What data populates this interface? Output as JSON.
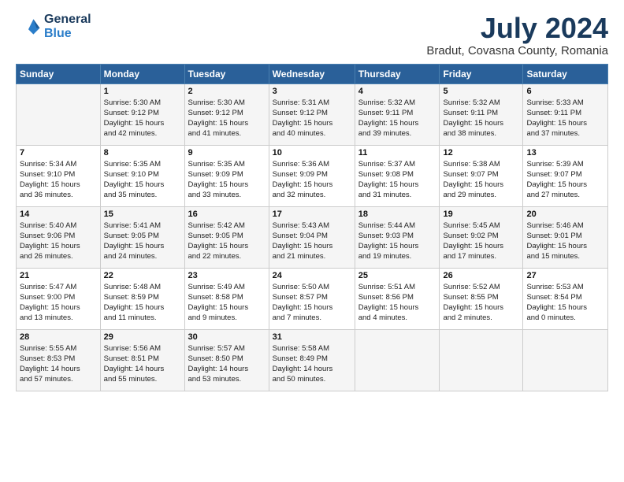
{
  "logo": {
    "line1": "General",
    "line2": "Blue"
  },
  "title": "July 2024",
  "location": "Bradut, Covasna County, Romania",
  "days_header": [
    "Sunday",
    "Monday",
    "Tuesday",
    "Wednesday",
    "Thursday",
    "Friday",
    "Saturday"
  ],
  "weeks": [
    [
      {
        "day": "",
        "content": ""
      },
      {
        "day": "1",
        "content": "Sunrise: 5:30 AM\nSunset: 9:12 PM\nDaylight: 15 hours\nand 42 minutes."
      },
      {
        "day": "2",
        "content": "Sunrise: 5:30 AM\nSunset: 9:12 PM\nDaylight: 15 hours\nand 41 minutes."
      },
      {
        "day": "3",
        "content": "Sunrise: 5:31 AM\nSunset: 9:12 PM\nDaylight: 15 hours\nand 40 minutes."
      },
      {
        "day": "4",
        "content": "Sunrise: 5:32 AM\nSunset: 9:11 PM\nDaylight: 15 hours\nand 39 minutes."
      },
      {
        "day": "5",
        "content": "Sunrise: 5:32 AM\nSunset: 9:11 PM\nDaylight: 15 hours\nand 38 minutes."
      },
      {
        "day": "6",
        "content": "Sunrise: 5:33 AM\nSunset: 9:11 PM\nDaylight: 15 hours\nand 37 minutes."
      }
    ],
    [
      {
        "day": "7",
        "content": "Sunrise: 5:34 AM\nSunset: 9:10 PM\nDaylight: 15 hours\nand 36 minutes."
      },
      {
        "day": "8",
        "content": "Sunrise: 5:35 AM\nSunset: 9:10 PM\nDaylight: 15 hours\nand 35 minutes."
      },
      {
        "day": "9",
        "content": "Sunrise: 5:35 AM\nSunset: 9:09 PM\nDaylight: 15 hours\nand 33 minutes."
      },
      {
        "day": "10",
        "content": "Sunrise: 5:36 AM\nSunset: 9:09 PM\nDaylight: 15 hours\nand 32 minutes."
      },
      {
        "day": "11",
        "content": "Sunrise: 5:37 AM\nSunset: 9:08 PM\nDaylight: 15 hours\nand 31 minutes."
      },
      {
        "day": "12",
        "content": "Sunrise: 5:38 AM\nSunset: 9:07 PM\nDaylight: 15 hours\nand 29 minutes."
      },
      {
        "day": "13",
        "content": "Sunrise: 5:39 AM\nSunset: 9:07 PM\nDaylight: 15 hours\nand 27 minutes."
      }
    ],
    [
      {
        "day": "14",
        "content": "Sunrise: 5:40 AM\nSunset: 9:06 PM\nDaylight: 15 hours\nand 26 minutes."
      },
      {
        "day": "15",
        "content": "Sunrise: 5:41 AM\nSunset: 9:05 PM\nDaylight: 15 hours\nand 24 minutes."
      },
      {
        "day": "16",
        "content": "Sunrise: 5:42 AM\nSunset: 9:05 PM\nDaylight: 15 hours\nand 22 minutes."
      },
      {
        "day": "17",
        "content": "Sunrise: 5:43 AM\nSunset: 9:04 PM\nDaylight: 15 hours\nand 21 minutes."
      },
      {
        "day": "18",
        "content": "Sunrise: 5:44 AM\nSunset: 9:03 PM\nDaylight: 15 hours\nand 19 minutes."
      },
      {
        "day": "19",
        "content": "Sunrise: 5:45 AM\nSunset: 9:02 PM\nDaylight: 15 hours\nand 17 minutes."
      },
      {
        "day": "20",
        "content": "Sunrise: 5:46 AM\nSunset: 9:01 PM\nDaylight: 15 hours\nand 15 minutes."
      }
    ],
    [
      {
        "day": "21",
        "content": "Sunrise: 5:47 AM\nSunset: 9:00 PM\nDaylight: 15 hours\nand 13 minutes."
      },
      {
        "day": "22",
        "content": "Sunrise: 5:48 AM\nSunset: 8:59 PM\nDaylight: 15 hours\nand 11 minutes."
      },
      {
        "day": "23",
        "content": "Sunrise: 5:49 AM\nSunset: 8:58 PM\nDaylight: 15 hours\nand 9 minutes."
      },
      {
        "day": "24",
        "content": "Sunrise: 5:50 AM\nSunset: 8:57 PM\nDaylight: 15 hours\nand 7 minutes."
      },
      {
        "day": "25",
        "content": "Sunrise: 5:51 AM\nSunset: 8:56 PM\nDaylight: 15 hours\nand 4 minutes."
      },
      {
        "day": "26",
        "content": "Sunrise: 5:52 AM\nSunset: 8:55 PM\nDaylight: 15 hours\nand 2 minutes."
      },
      {
        "day": "27",
        "content": "Sunrise: 5:53 AM\nSunset: 8:54 PM\nDaylight: 15 hours\nand 0 minutes."
      }
    ],
    [
      {
        "day": "28",
        "content": "Sunrise: 5:55 AM\nSunset: 8:53 PM\nDaylight: 14 hours\nand 57 minutes."
      },
      {
        "day": "29",
        "content": "Sunrise: 5:56 AM\nSunset: 8:51 PM\nDaylight: 14 hours\nand 55 minutes."
      },
      {
        "day": "30",
        "content": "Sunrise: 5:57 AM\nSunset: 8:50 PM\nDaylight: 14 hours\nand 53 minutes."
      },
      {
        "day": "31",
        "content": "Sunrise: 5:58 AM\nSunset: 8:49 PM\nDaylight: 14 hours\nand 50 minutes."
      },
      {
        "day": "",
        "content": ""
      },
      {
        "day": "",
        "content": ""
      },
      {
        "day": "",
        "content": ""
      }
    ]
  ]
}
